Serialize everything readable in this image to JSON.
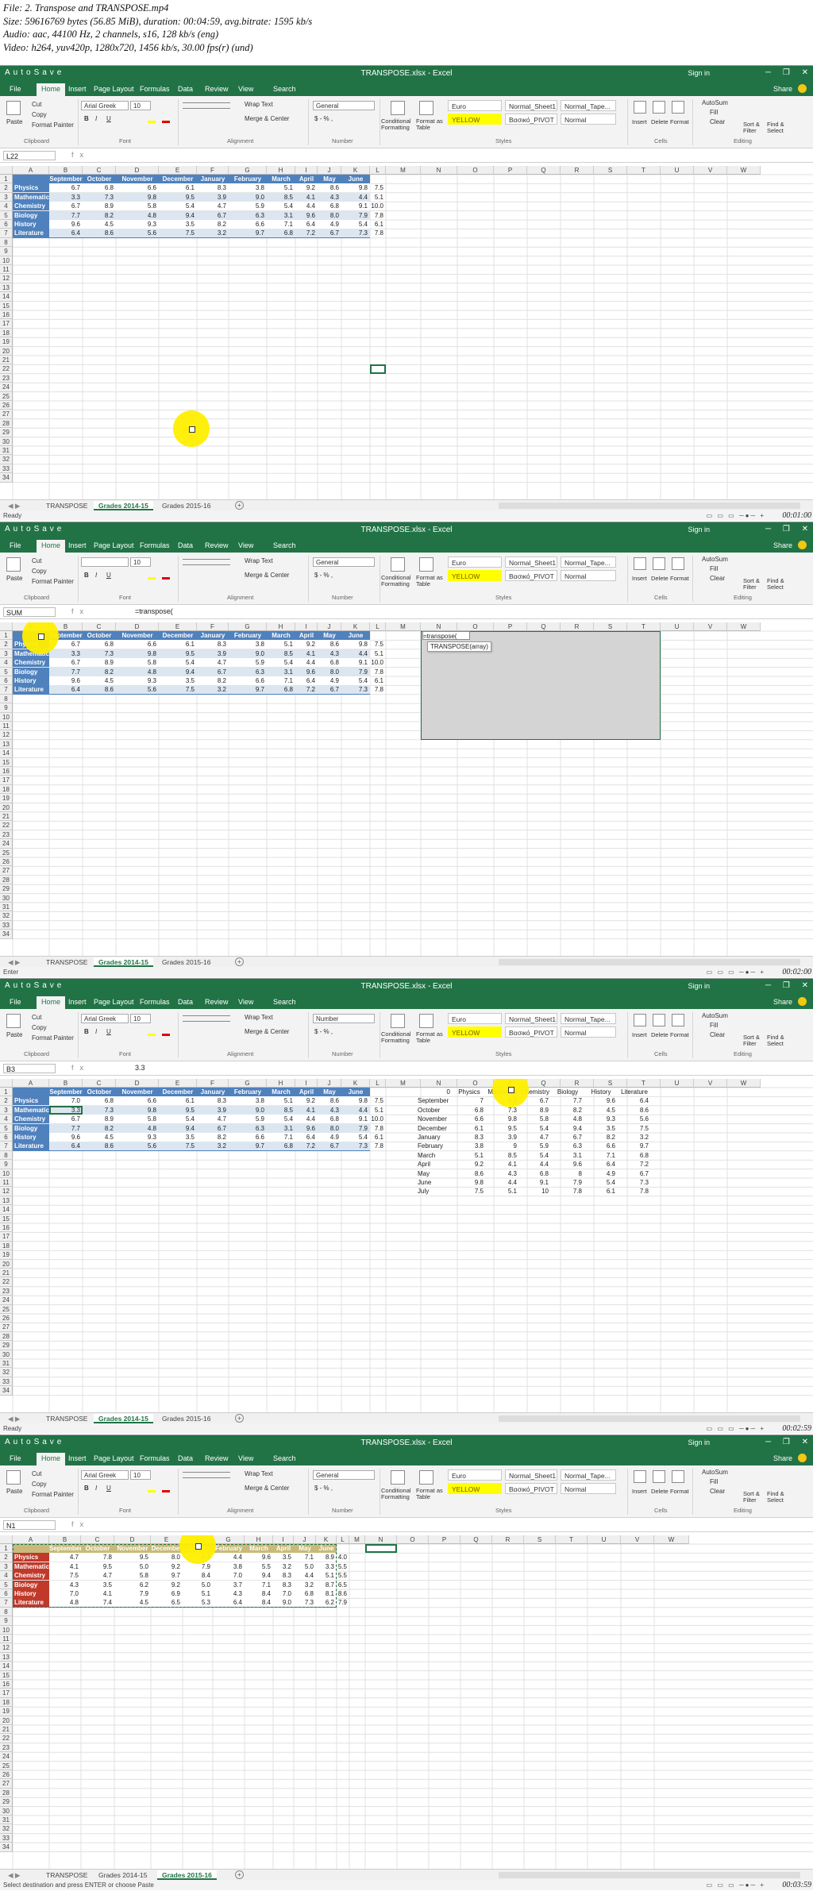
{
  "file_info": {
    "line1": "File: 2. Transpose and TRANSPOSE.mp4",
    "line2": "Size: 59616769 bytes (56.85 MiB), duration: 00:04:59, avg.bitrate: 1595 kb/s",
    "line3": "Audio: aac, 44100 Hz, 2 channels, s16, 128 kb/s (eng)",
    "line4": "Video: h264, yuv420p, 1280x720, 1456 kb/s, 30.00 fps(r) (und)"
  },
  "common": {
    "window_title": "TRANSPOSE.xlsx - Excel",
    "quick_access": "AutoSave",
    "sign_in": "Sign in",
    "window_controls": "─ ❐ ✕",
    "tabs": [
      "File",
      "Home",
      "Insert",
      "Page Layout",
      "Formulas",
      "Data",
      "Review",
      "View"
    ],
    "tell_me": "Search",
    "share": "Share",
    "clipboard": {
      "paste": "Paste",
      "cut": "Cut",
      "copy": "Copy",
      "format_painter": "Format Painter",
      "label": "Clipboard"
    },
    "font_label": "Font",
    "font_bold": "B",
    "font_italic": "I",
    "font_underline": "U",
    "alignment": {
      "wrap": "Wrap Text",
      "merge": "Merge & Center",
      "label": "Alignment"
    },
    "number": {
      "currency": "$ - % ,",
      "label": "Number"
    },
    "styles": {
      "conditional": "Conditional Formatting",
      "format_table": "Format as Table",
      "euro": "Euro",
      "yellow": "YELLOW",
      "normal_sheet1": "Normal_Sheet1",
      "normal_pivot": "Βασικό_PIVOT",
      "normal_tape": "Normal_Tape...",
      "normal": "Normal",
      "label": "Styles"
    },
    "cells": {
      "insert": "Insert",
      "delete": "Delete",
      "format": "Format",
      "label": "Cells"
    },
    "editing": {
      "autosum": "AutoSum",
      "fill": "Fill",
      "clear": "Clear",
      "sort": "Sort & Filter",
      "find": "Find & Select",
      "label": "Editing"
    },
    "columns": [
      "A",
      "B",
      "C",
      "D",
      "E",
      "F",
      "G",
      "H",
      "I",
      "J",
      "K",
      "L",
      "M",
      "N",
      "O",
      "P",
      "Q",
      "R",
      "S",
      "T",
      "U",
      "V",
      "W"
    ],
    "fx": "fx"
  },
  "frames": [
    {
      "name_box": "L22",
      "formula": "",
      "font_name": "Arial Greek",
      "font_size": "10",
      "number_format": "General",
      "sheets": [
        "TRANSPOSE",
        "Grades 2014-15",
        "Grades 2015-16"
      ],
      "active_sheet": 1,
      "status": "Ready",
      "timestamp": "00:01:00",
      "table": {
        "months": [
          "September",
          "October",
          "November",
          "December",
          "January",
          "February",
          "March",
          "April",
          "May",
          "June",
          "July"
        ],
        "rows": [
          {
            "subject": "Physics",
            "values": [
              "6.7",
              "6.8",
              "6.6",
              "6.1",
              "8.3",
              "3.8",
              "5.1",
              "9.2",
              "8.6",
              "9.8",
              "7.5"
            ]
          },
          {
            "subject": "Mathematics",
            "values": [
              "3.3",
              "7.3",
              "9.8",
              "9.5",
              "3.9",
              "9.0",
              "8.5",
              "4.1",
              "4.3",
              "4.4",
              "5.1"
            ]
          },
          {
            "subject": "Chemistry",
            "values": [
              "6.7",
              "8.9",
              "5.8",
              "5.4",
              "4.7",
              "5.9",
              "5.4",
              "4.4",
              "6.8",
              "9.1",
              "10.0"
            ]
          },
          {
            "subject": "Biology",
            "values": [
              "7.7",
              "8.2",
              "4.8",
              "9.4",
              "6.7",
              "6.3",
              "3.1",
              "9.6",
              "8.0",
              "7.9",
              "7.8"
            ]
          },
          {
            "subject": "History",
            "values": [
              "9.6",
              "4.5",
              "9.3",
              "3.5",
              "8.2",
              "6.6",
              "7.1",
              "6.4",
              "4.9",
              "5.4",
              "6.1"
            ]
          },
          {
            "subject": "Literature",
            "values": [
              "6.4",
              "8.6",
              "5.6",
              "7.5",
              "3.2",
              "9.7",
              "6.8",
              "7.2",
              "6.7",
              "7.3",
              "7.8"
            ]
          }
        ]
      }
    },
    {
      "name_box": "SUM",
      "formula": "=transpose(",
      "font_name": "",
      "font_size": "10",
      "number_format": "General",
      "sheets": [
        "TRANSPOSE",
        "Grades 2014-15",
        "Grades 2015-16"
      ],
      "active_sheet": 1,
      "status": "Enter",
      "timestamp": "00:02:00",
      "cell_edit": "=transpose(",
      "tooltip": "TRANSPOSE(array)",
      "table": {
        "months": [
          "September",
          "October",
          "November",
          "December",
          "January",
          "February",
          "March",
          "April",
          "May",
          "June",
          "July"
        ],
        "rows": [
          {
            "subject": "Physics",
            "values": [
              "6.7",
              "6.8",
              "6.6",
              "6.1",
              "8.3",
              "3.8",
              "5.1",
              "9.2",
              "8.6",
              "9.8",
              "7.5"
            ]
          },
          {
            "subject": "Mathematics",
            "values": [
              "3.3",
              "7.3",
              "9.8",
              "9.5",
              "3.9",
              "9.0",
              "8.5",
              "4.1",
              "4.3",
              "4.4",
              "5.1"
            ]
          },
          {
            "subject": "Chemistry",
            "values": [
              "6.7",
              "8.9",
              "5.8",
              "5.4",
              "4.7",
              "5.9",
              "5.4",
              "4.4",
              "6.8",
              "9.1",
              "10.0"
            ]
          },
          {
            "subject": "Biology",
            "values": [
              "7.7",
              "8.2",
              "4.8",
              "9.4",
              "6.7",
              "6.3",
              "3.1",
              "9.6",
              "8.0",
              "7.9",
              "7.8"
            ]
          },
          {
            "subject": "History",
            "values": [
              "9.6",
              "4.5",
              "9.3",
              "3.5",
              "8.2",
              "6.6",
              "7.1",
              "6.4",
              "4.9",
              "5.4",
              "6.1"
            ]
          },
          {
            "subject": "Literature",
            "values": [
              "6.4",
              "8.6",
              "5.6",
              "7.5",
              "3.2",
              "9.7",
              "6.8",
              "7.2",
              "6.7",
              "7.3",
              "7.8"
            ]
          }
        ]
      }
    },
    {
      "name_box": "B3",
      "formula": "3.3",
      "font_name": "Arial Greek",
      "font_size": "10",
      "number_format": "Number",
      "sheets": [
        "TRANSPOSE",
        "Grades 2014-15",
        "Grades 2015-16"
      ],
      "active_sheet": 1,
      "status": "Ready",
      "timestamp": "00:02:59",
      "table": {
        "months": [
          "September",
          "October",
          "November",
          "December",
          "January",
          "February",
          "March",
          "April",
          "May",
          "June",
          "July"
        ],
        "rows": [
          {
            "subject": "Physics",
            "values": [
              "7.0",
              "6.8",
              "6.6",
              "6.1",
              "8.3",
              "3.8",
              "5.1",
              "9.2",
              "8.6",
              "9.8",
              "7.5"
            ]
          },
          {
            "subject": "Mathematics",
            "values": [
              "3.3",
              "7.3",
              "9.8",
              "9.5",
              "3.9",
              "9.0",
              "8.5",
              "4.1",
              "4.3",
              "4.4",
              "5.1"
            ]
          },
          {
            "subject": "Chemistry",
            "values": [
              "6.7",
              "8.9",
              "5.8",
              "5.4",
              "4.7",
              "5.9",
              "5.4",
              "4.4",
              "6.8",
              "9.1",
              "10.0"
            ]
          },
          {
            "subject": "Biology",
            "values": [
              "7.7",
              "8.2",
              "4.8",
              "9.4",
              "6.7",
              "6.3",
              "3.1",
              "9.6",
              "8.0",
              "7.9",
              "7.8"
            ]
          },
          {
            "subject": "History",
            "values": [
              "9.6",
              "4.5",
              "9.3",
              "3.5",
              "8.2",
              "6.6",
              "7.1",
              "6.4",
              "4.9",
              "5.4",
              "6.1"
            ]
          },
          {
            "subject": "Literature",
            "values": [
              "6.4",
              "8.6",
              "5.6",
              "7.5",
              "3.2",
              "9.7",
              "6.8",
              "7.2",
              "6.7",
              "7.3",
              "7.8"
            ]
          }
        ]
      },
      "transposed": {
        "header": [
          "0",
          "Physics",
          "Mathemati",
          "Chemistry",
          "Biology",
          "History",
          "Literature"
        ],
        "rows": [
          [
            "September",
            "7",
            "3.3",
            "6.7",
            "7.7",
            "9.6",
            "6.4"
          ],
          [
            "October",
            "6.8",
            "7.3",
            "8.9",
            "8.2",
            "4.5",
            "8.6"
          ],
          [
            "November",
            "6.6",
            "9.8",
            "5.8",
            "4.8",
            "9.3",
            "5.6"
          ],
          [
            "December",
            "6.1",
            "9.5",
            "5.4",
            "9.4",
            "3.5",
            "7.5"
          ],
          [
            "January",
            "8.3",
            "3.9",
            "4.7",
            "6.7",
            "8.2",
            "3.2"
          ],
          [
            "February",
            "3.8",
            "9",
            "5.9",
            "6.3",
            "6.6",
            "9.7"
          ],
          [
            "March",
            "5.1",
            "8.5",
            "5.4",
            "3.1",
            "7.1",
            "6.8"
          ],
          [
            "April",
            "9.2",
            "4.1",
            "4.4",
            "9.6",
            "6.4",
            "7.2"
          ],
          [
            "May",
            "8.6",
            "4.3",
            "6.8",
            "8",
            "4.9",
            "6.7"
          ],
          [
            "June",
            "9.8",
            "4.4",
            "9.1",
            "7.9",
            "5.4",
            "7.3"
          ],
          [
            "July",
            "7.5",
            "5.1",
            "10",
            "7.8",
            "6.1",
            "7.8"
          ]
        ]
      }
    },
    {
      "name_box": "N1",
      "formula": "",
      "font_name": "Arial Greek",
      "font_size": "10",
      "number_format": "General",
      "sheets": [
        "TRANSPOSE",
        "Grades 2014-15",
        "Grades 2015-16"
      ],
      "active_sheet": 2,
      "status": "Select destination and press ENTER or choose Paste",
      "timestamp": "00:03:59",
      "table": {
        "months": [
          "September",
          "October",
          "November",
          "December",
          "January",
          "February",
          "March",
          "April",
          "May",
          "June",
          "July"
        ],
        "rows": [
          {
            "subject": "Physics",
            "values": [
              "4.7",
              "7.8",
              "9.5",
              "8.0",
              "6.3",
              "4.4",
              "9.6",
              "3.5",
              "7.1",
              "8.9",
              "4.0"
            ]
          },
          {
            "subject": "Mathematics",
            "values": [
              "4.1",
              "9.5",
              "5.0",
              "9.2",
              "7.9",
              "3.8",
              "5.5",
              "3.2",
              "5.0",
              "3.3",
              "5.5"
            ]
          },
          {
            "subject": "Chemistry",
            "values": [
              "7.5",
              "4.7",
              "5.8",
              "9.7",
              "8.4",
              "7.0",
              "9.4",
              "8.3",
              "4.4",
              "5.1",
              "5.5"
            ]
          },
          {
            "subject": "Biology",
            "values": [
              "4.3",
              "3.5",
              "6.2",
              "9.2",
              "5.0",
              "3.7",
              "7.1",
              "8.3",
              "3.2",
              "8.7",
              "6.5"
            ]
          },
          {
            "subject": "History",
            "values": [
              "7.0",
              "4.1",
              "7.9",
              "6.9",
              "5.1",
              "4.3",
              "8.4",
              "7.0",
              "6.8",
              "8.1",
              "8.6"
            ]
          },
          {
            "subject": "Literature",
            "values": [
              "4.8",
              "7.4",
              "4.5",
              "6.5",
              "5.3",
              "6.4",
              "8.4",
              "9.0",
              "7.3",
              "6.2",
              "7.9"
            ]
          }
        ]
      }
    }
  ]
}
